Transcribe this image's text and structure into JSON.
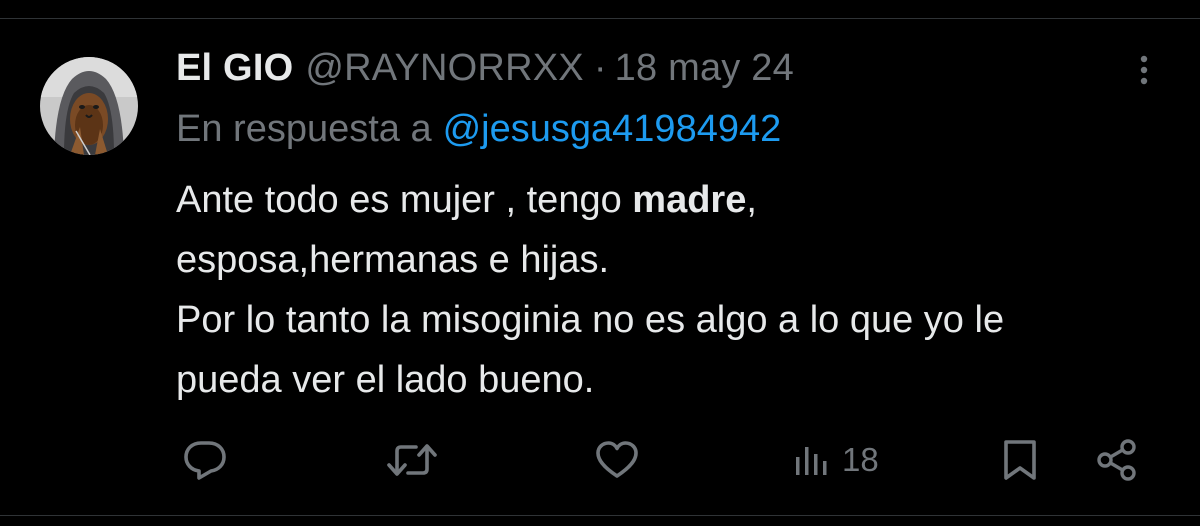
{
  "tweet": {
    "author": {
      "display_name": "El GIO",
      "handle": "@RAYNORRXX",
      "separator": "·",
      "date": "18 may 24"
    },
    "reply": {
      "prefix": "En respuesta a",
      "handle": "@jesusga41984942"
    },
    "text": {
      "line1_pre": "Ante todo es mujer , tengo ",
      "line1_bold": "madre",
      "line1_post": ",",
      "line2": "esposa,hermanas e hijas.",
      "line3": "Por lo tanto la misoginia no es algo a lo que yo le",
      "line4": "pueda ver el lado bueno."
    },
    "actions": {
      "reply_icon": "reply-icon",
      "retweet_icon": "retweet-icon",
      "like_icon": "heart-icon",
      "views_icon": "views-icon",
      "views_count": "18",
      "bookmark_icon": "bookmark-icon",
      "share_icon": "share-icon"
    },
    "colors": {
      "background": "#000000",
      "text": "#e7e9ea",
      "muted": "#71767b",
      "link": "#1d9bf0",
      "divider": "#2f3336"
    }
  }
}
